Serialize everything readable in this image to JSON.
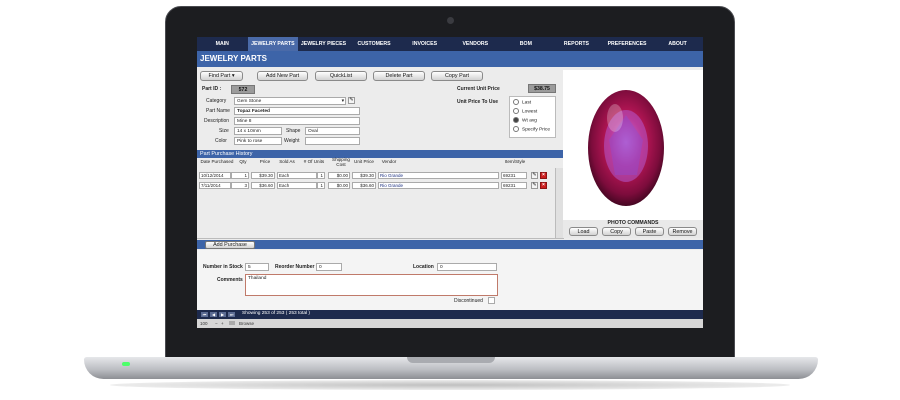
{
  "nav": [
    "MAIN",
    "JEWELRY PARTS",
    "JEWELRY PIECES",
    "CUSTOMERS",
    "INVOICES",
    "VENDORS",
    "BOM",
    "REPORTS",
    "PREFERENCES",
    "ABOUT"
  ],
  "page_title": "JEWELRY PARTS",
  "toolbar": {
    "find": "Find Part",
    "add": "Add New Part",
    "quicklist": "QuickList",
    "delete": "Delete Part",
    "copy": "Copy Part"
  },
  "part": {
    "id_label": "Part ID :",
    "id": "572",
    "current_price_label": "Current Unit Price",
    "current_price": "$38.75",
    "category_label": "Category",
    "category": "Gem Stone",
    "name_label": "Part Name",
    "name": "Topaz Faceted",
    "description_label": "Description",
    "description": "Mine 8",
    "size_label": "Size",
    "size": "14 x 10mm",
    "shape_label": "Shape",
    "shape": "Oval",
    "color_label": "Color",
    "color": "Pink to rose",
    "weight_label": "Weight",
    "weight": ""
  },
  "unit_price_to_use": {
    "label": "Unit Price To Use",
    "options": [
      "Last",
      "Lowest",
      "Wt avg",
      "Specify Price"
    ],
    "selected": 2
  },
  "history": {
    "title": "Part Purchase History",
    "columns": [
      "Date Purchased",
      "Qty",
      "Price",
      "Sold As",
      "# Of Units",
      "Shipping Cost",
      "Unit Price",
      "Vendor",
      "Item/Style"
    ],
    "rows": [
      [
        "10/12/2014",
        "1",
        "$39.30",
        "Each",
        "1",
        "$0.00",
        "$39.30",
        "Rio Grande",
        "69231"
      ],
      [
        "7/11/2014",
        "3",
        "$36.60",
        "Each",
        "1",
        "$0.00",
        "$36.60",
        "Rio Grande",
        "69231"
      ]
    ]
  },
  "add_purchase": "Add Purchase",
  "stock": {
    "number_label": "Number in Stock",
    "number": "5",
    "reorder_label": "Reorder Number",
    "reorder": "0",
    "location_label": "Location",
    "location": "0",
    "comments_label": "Comments",
    "comments": "Thailand",
    "discontinued_label": "Discontinued"
  },
  "photo": {
    "commands_label": "PHOTO COMMANDS",
    "buttons": [
      "Load",
      "Copy",
      "Paste",
      "Remove"
    ]
  },
  "status": {
    "records": "Showing 253 of 253 ( 253 total )",
    "zoom": "100",
    "mode": "Browse"
  },
  "colors": {
    "nav": "#1d2a4d",
    "accent": "#3d64a8",
    "gem": "#c2185b"
  }
}
